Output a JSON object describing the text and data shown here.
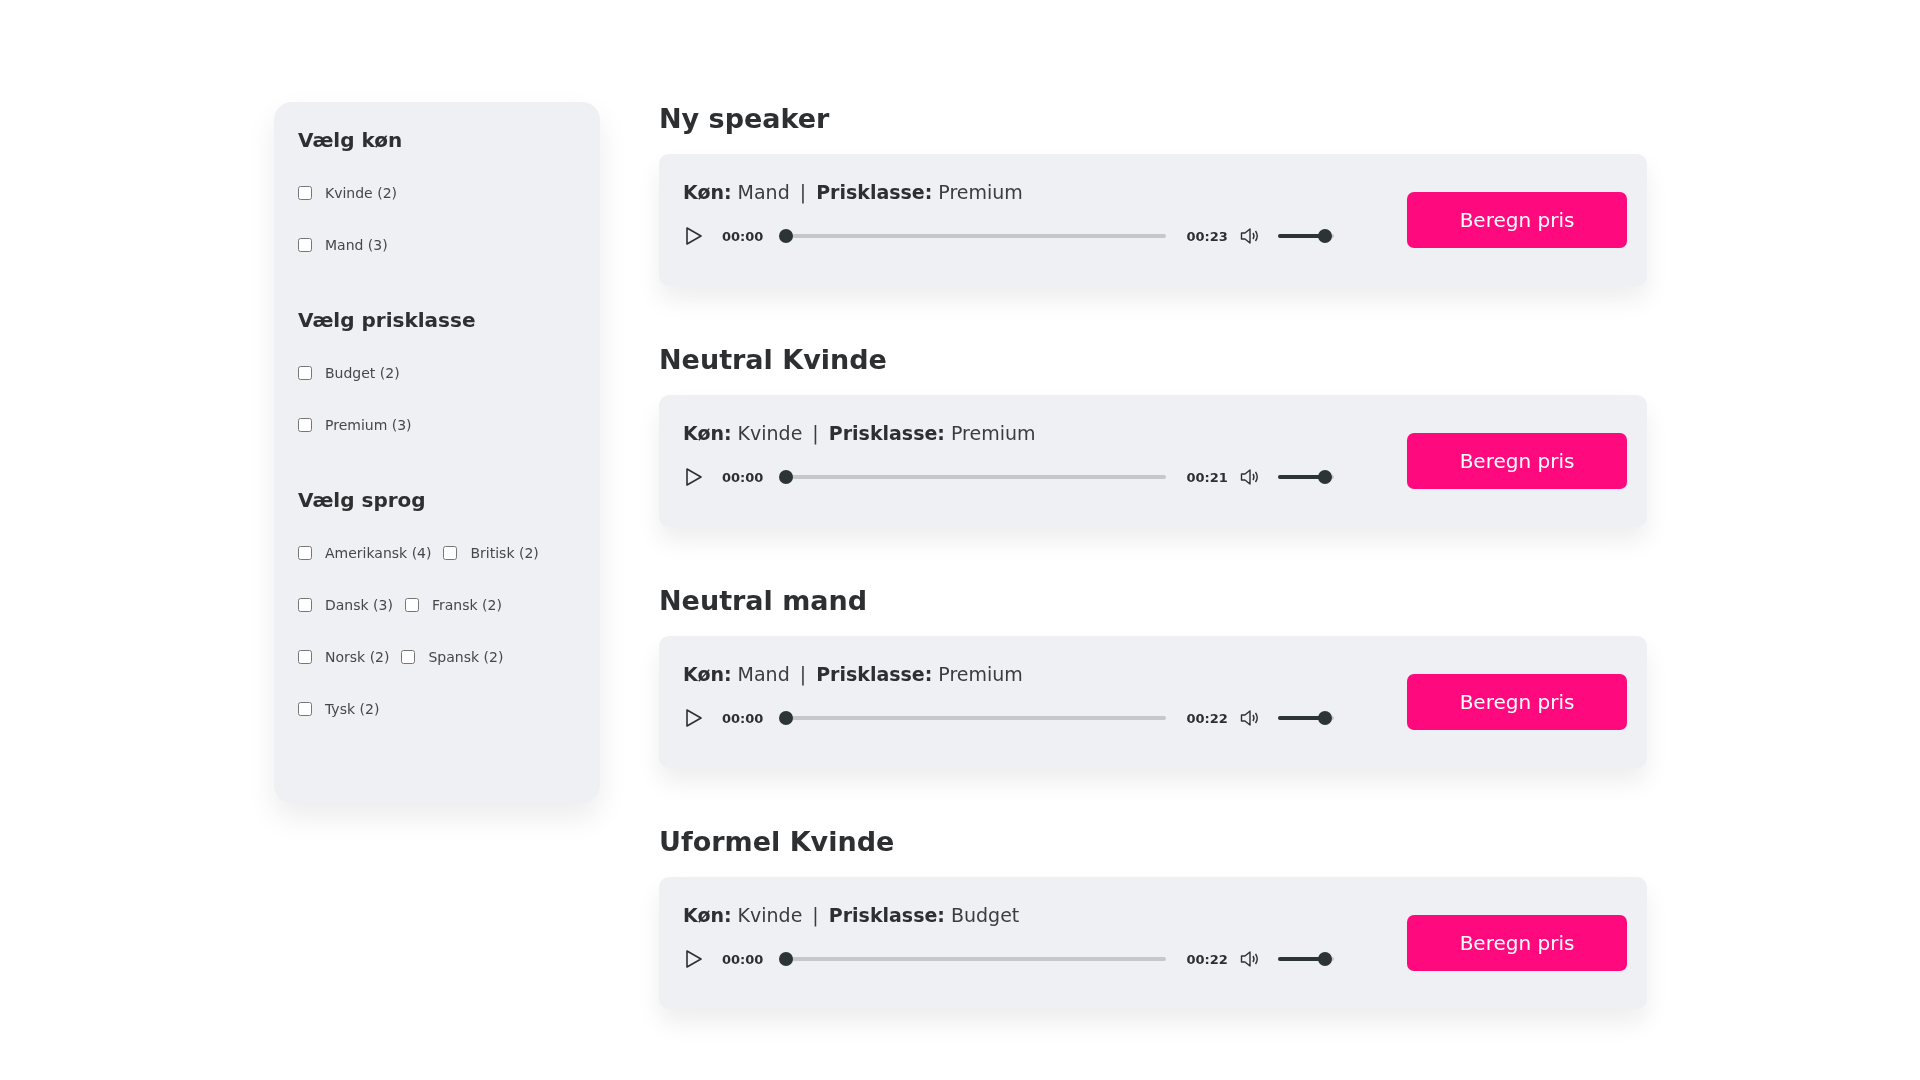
{
  "filters": [
    {
      "title": "Vælg køn",
      "kind": "list",
      "options": [
        {
          "label": "Kvinde (2)",
          "checked": false
        },
        {
          "label": "Mand (3)",
          "checked": false
        }
      ]
    },
    {
      "title": "Vælg prisklasse",
      "kind": "list",
      "options": [
        {
          "label": "Budget (2)",
          "checked": false
        },
        {
          "label": "Premium (3)",
          "checked": false
        }
      ]
    },
    {
      "title": "Vælg sprog",
      "kind": "inline",
      "options": [
        {
          "label": "Amerikansk (4)",
          "checked": false
        },
        {
          "label": "Britisk (2)",
          "checked": false
        },
        {
          "label": "Dansk (3)",
          "checked": false
        },
        {
          "label": "Fransk (2)",
          "checked": false
        },
        {
          "label": "Norsk (2)",
          "checked": false
        },
        {
          "label": "Spansk (2)",
          "checked": false
        },
        {
          "label": "Tysk (2)",
          "checked": false
        }
      ]
    }
  ],
  "speakers": [
    {
      "name": "Ny speaker",
      "gender_label": "Køn:",
      "gender": "Mand",
      "separator": "|",
      "price_label": "Prisklasse:",
      "price": "Premium",
      "current_time": "00:00",
      "duration": "00:23",
      "progress": {
        "level": 0
      },
      "volume": {
        "level": 0.85
      },
      "button": "Beregn pris"
    },
    {
      "name": "Neutral Kvinde",
      "gender_label": "Køn:",
      "gender": "Kvinde",
      "separator": "|",
      "price_label": "Prisklasse:",
      "price": "Premium",
      "current_time": "00:00",
      "duration": "00:21",
      "progress": {
        "level": 0
      },
      "volume": {
        "level": 0.85
      },
      "button": "Beregn pris"
    },
    {
      "name": "Neutral mand",
      "gender_label": "Køn:",
      "gender": "Mand",
      "separator": "|",
      "price_label": "Prisklasse:",
      "price": "Premium",
      "current_time": "00:00",
      "duration": "00:22",
      "progress": {
        "level": 0
      },
      "volume": {
        "level": 0.85
      },
      "button": "Beregn pris"
    },
    {
      "name": "Uformel Kvinde",
      "gender_label": "Køn:",
      "gender": "Kvinde",
      "separator": "|",
      "price_label": "Prisklasse:",
      "price": "Budget",
      "current_time": "00:00",
      "duration": "00:22",
      "progress": {
        "level": 0
      },
      "volume": {
        "level": 0.85
      },
      "button": "Beregn pris"
    }
  ]
}
